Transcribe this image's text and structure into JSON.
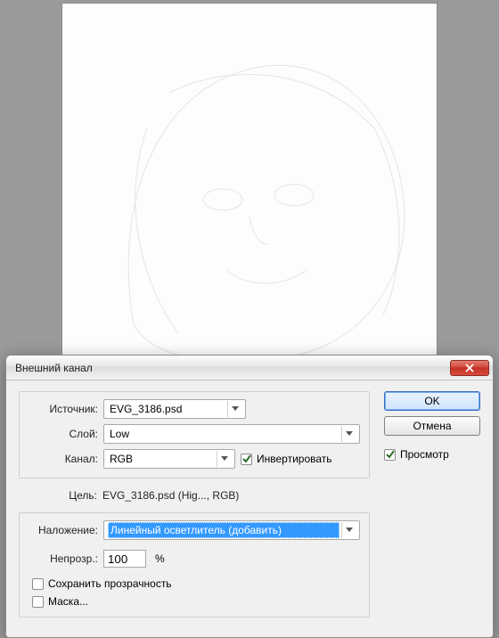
{
  "dialog": {
    "title": "Внешний канал",
    "close_icon": "close",
    "source": {
      "label": "Источник:",
      "value": "EVG_3186.psd",
      "layer_label": "Слой:",
      "layer_value": "Low",
      "channel_label": "Канал:",
      "channel_value": "RGB",
      "invert_label": "Инвертировать",
      "invert_checked": true
    },
    "target": {
      "label": "Цель:",
      "value": "EVG_3186.psd (Hig..., RGB)"
    },
    "blend": {
      "mode_label": "Наложение:",
      "mode_value": "Линейный осветлитель (добавить)",
      "opacity_label": "Непрозр.:",
      "opacity_value": "100",
      "opacity_suffix": "%",
      "preserve_label": "Сохранить прозрачность",
      "preserve_checked": false,
      "mask_label": "Маска...",
      "mask_checked": false
    },
    "buttons": {
      "ok": "OK",
      "cancel": "Отмена",
      "preview_label": "Просмотр",
      "preview_checked": true
    }
  }
}
